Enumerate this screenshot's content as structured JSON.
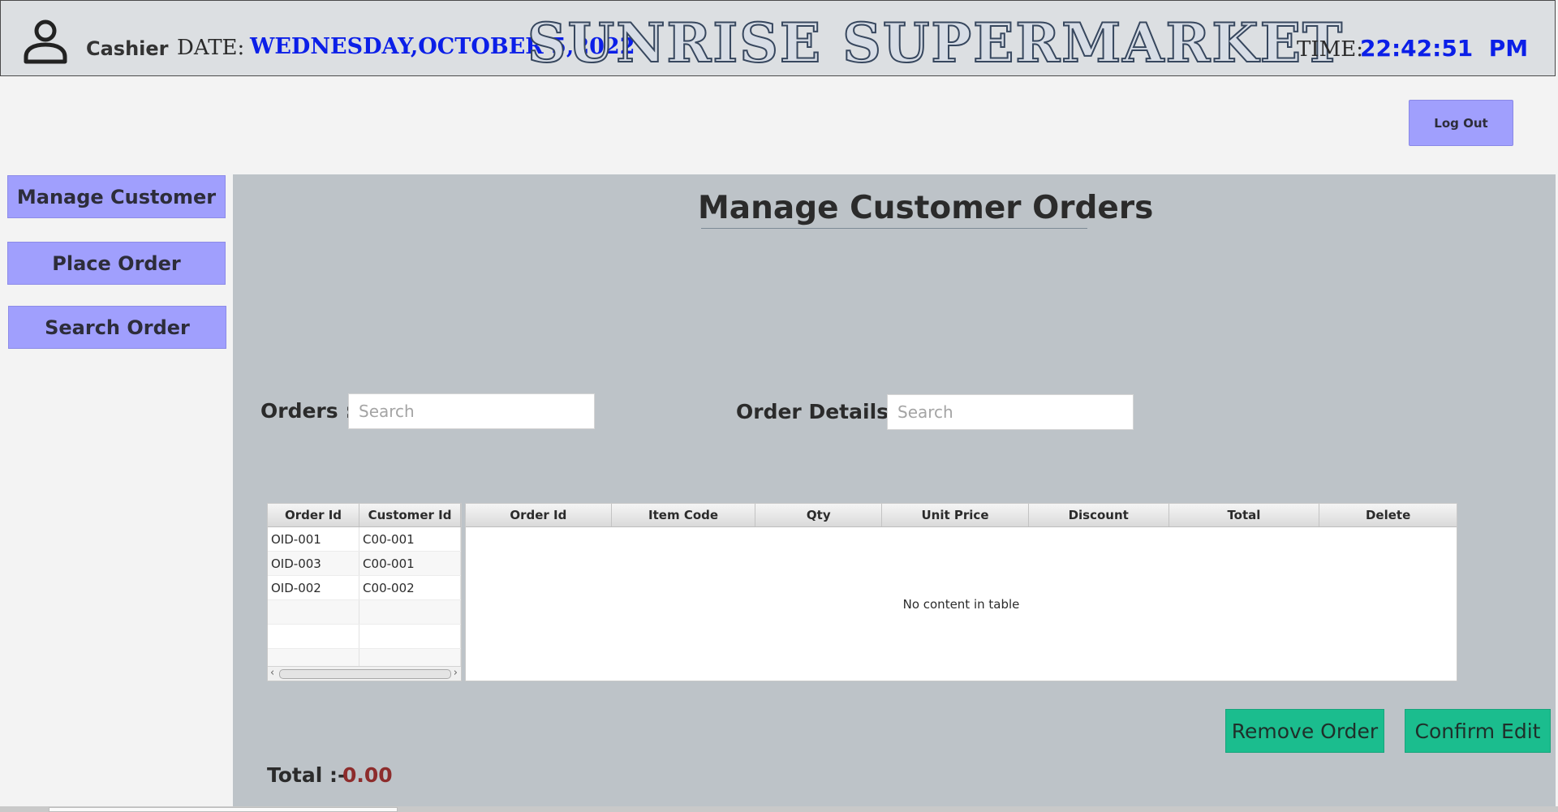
{
  "header": {
    "role": "Cashier",
    "date_caption": "DATE:",
    "date_value": "WEDNESDAY,OCTOBER 5,2022",
    "store_title": "SUNRISE SUPERMARKET",
    "time_caption": "TIME:",
    "time_value": "22:42:51  PM",
    "logout_label": "Log Out"
  },
  "sidebar": {
    "items": [
      {
        "label": "Manage Customer"
      },
      {
        "label": "Place Order"
      },
      {
        "label": "Search Order"
      }
    ]
  },
  "main": {
    "title": "Manage Customer Orders",
    "orders_label": "Orders :-",
    "orders_search_placeholder": "Search",
    "details_label": "Order Details :-",
    "details_search_placeholder": "Search",
    "orders_table": {
      "columns": [
        "Order Id",
        "Customer Id"
      ],
      "rows": [
        [
          "OID-001",
          "C00-001"
        ],
        [
          "OID-003",
          "C00-001"
        ],
        [
          "OID-002",
          "C00-002"
        ]
      ]
    },
    "details_table": {
      "columns": [
        "Order Id",
        "Item Code",
        "Qty",
        "Unit Price",
        "Discount",
        "Total",
        "Delete"
      ],
      "empty_text": "No content in table"
    },
    "remove_order_label": "Remove Order",
    "confirm_edit_label": "Confirm Edit",
    "total_label": "Total :-",
    "total_value": "0.00"
  },
  "colors": {
    "accent_button": "#a09ffd",
    "action_button": "#1bbd8e",
    "date_time_blue": "#0b1fe8",
    "total_value": "#8d2c2c"
  },
  "icons": {
    "user": "user-icon"
  }
}
